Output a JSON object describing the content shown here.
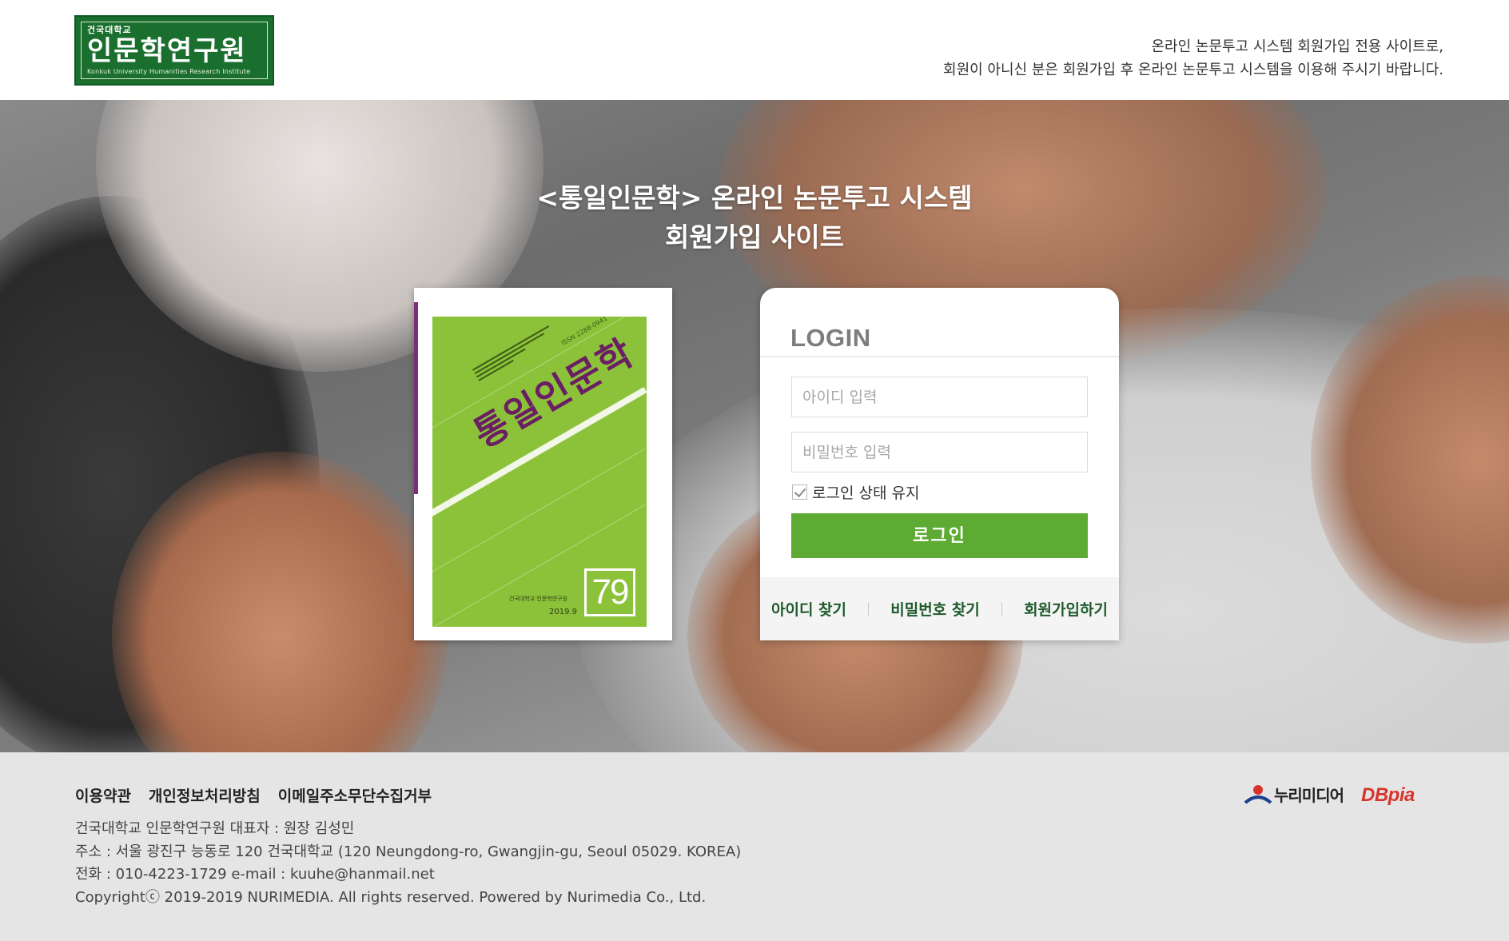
{
  "header": {
    "logo": {
      "small_text": "건국대학교",
      "main_text": "인문학연구원",
      "sub_text": "Konkuk University Humanities Research Institute"
    },
    "notice_line1": "온라인 논문투고 시스템 회원가입 전용 사이트로,",
    "notice_line2": "회원이 아니신 분은 회원가입 후 온라인 논문투고 시스템을 이용해 주시기 바랍니다."
  },
  "hero": {
    "title_line1": "<통일인문학> 온라인 논문투고 시스템",
    "title_line2": "회원가입 사이트"
  },
  "cover": {
    "title": "통일인문학",
    "issn": "ISSN 2288-0941",
    "publisher": "건국대학교 인문학연구원",
    "date": "2019.9",
    "issue": "79"
  },
  "login": {
    "title": "LOGIN",
    "id_placeholder": "아이디 입력",
    "pw_placeholder": "비밀번호 입력",
    "keep_label": "로그인 상태 유지",
    "keep_checked": true,
    "submit_label": "로그인",
    "links": {
      "find_id": "아이디 찾기",
      "find_pw": "비밀번호 찾기",
      "signup": "회원가입하기"
    },
    "accent_color": "#5eab33"
  },
  "footer": {
    "links": [
      "이용약관",
      "개인정보처리방침",
      "이메일주소무단수집거부"
    ],
    "info": [
      "건국대학교 인문학연구원 대표자 : 원장 김성민",
      "주소 : 서울 광진구 능동로 120 건국대학교 (120 Neungdong-ro, Gwangjin-gu, Seoul 05029. KOREA)",
      "전화 : 010-4223-1729 e-mail : kuuhe@hanmail.net",
      "Copyrightⓒ 2019-2019 NURIMEDIA. All rights reserved. Powered by Nurimedia Co., Ltd."
    ],
    "brand_nurimedia": "누리미디어",
    "brand_dbpia": "DBpia"
  }
}
